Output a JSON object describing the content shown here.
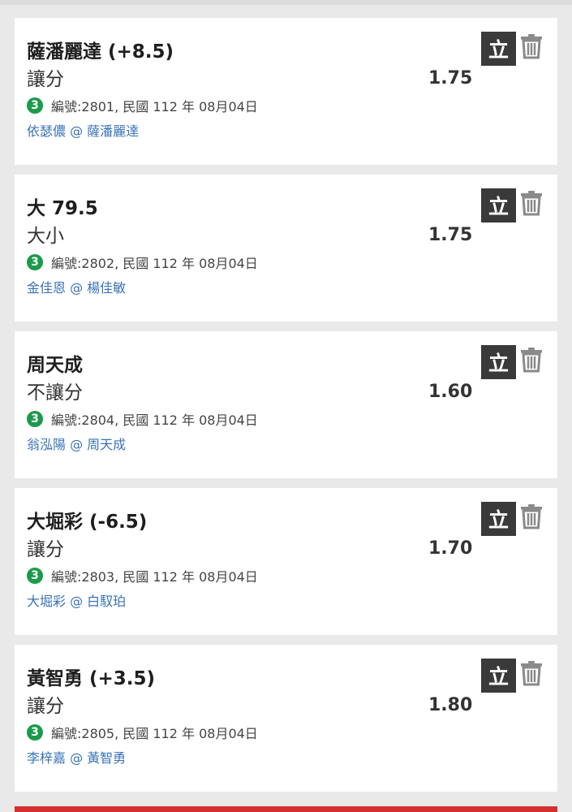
{
  "bets": [
    {
      "selection": "薩潘麗達 (+8.5)",
      "market": "讓分",
      "odds": "1.75",
      "badge": "3",
      "info": "編號:2801, 民國 112 年 08月04日",
      "match": "依瑟儂 @ 薩潘麗達",
      "lock_label": "立"
    },
    {
      "selection": "大 79.5",
      "market": "大小",
      "odds": "1.75",
      "badge": "3",
      "info": "編號:2802, 民國 112 年 08月04日",
      "match": "金佳恩 @ 楊佳敏",
      "lock_label": "立"
    },
    {
      "selection": "周天成",
      "market": "不讓分",
      "odds": "1.60",
      "badge": "3",
      "info": "編號:2804, 民國 112 年 08月04日",
      "match": "翁泓陽 @ 周天成",
      "lock_label": "立"
    },
    {
      "selection": "大堀彩 (-6.5)",
      "market": "讓分",
      "odds": "1.70",
      "badge": "3",
      "info": "編號:2803, 民國 112 年 08月04日",
      "match": "大堀彩 @ 白馭珀",
      "lock_label": "立"
    },
    {
      "selection": "黃智勇 (+3.5)",
      "market": "讓分",
      "odds": "1.80",
      "badge": "3",
      "info": "編號:2805, 民國 112 年 08月04日",
      "match": "李梓嘉 @ 黃智勇",
      "lock_label": "立"
    }
  ],
  "icons": {
    "delete": "trash-icon",
    "badge": "number-circle-icon"
  },
  "colors": {
    "badge": "#1a9b4a",
    "match_link": "#3a73b8",
    "lock_button": "#3a3a3a",
    "bottom_bar": "#d32f2f"
  }
}
